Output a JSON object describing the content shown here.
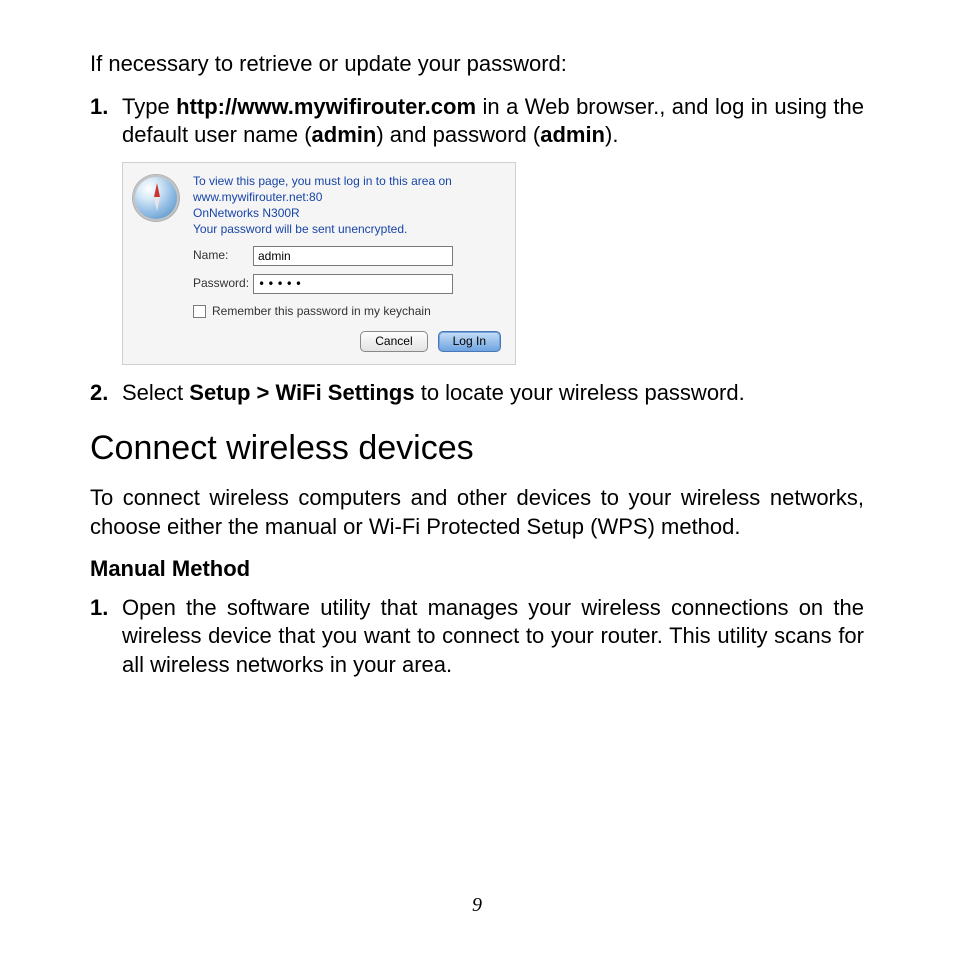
{
  "intro": "If necessary to retrieve or update your password:",
  "step1": {
    "num": "1.",
    "before": "Type ",
    "url": "http://www.mywifirouter.com",
    "mid1": " in a Web browser., and log in using the default user name (",
    "user": "admin",
    "mid2": ") and password (",
    "pass": "admin",
    "after": ")."
  },
  "dialog": {
    "msg_l1": "To view this page, you must log in to this area on",
    "msg_l2": "www.mywifirouter.net:80",
    "msg_l3": "OnNetworks N300R",
    "msg_l4": "Your password will be sent unencrypted.",
    "name_label": "Name:",
    "name_value": "admin",
    "password_label": "Password:",
    "password_value": "•••••",
    "remember_label": "Remember this password in my keychain",
    "cancel": "Cancel",
    "login": "Log In"
  },
  "step2": {
    "num": "2.",
    "before": "Select ",
    "bold": "Setup > WiFi Settings",
    "after": " to locate your wireless password."
  },
  "section_title": "Connect wireless devices",
  "para": "To connect wireless computers and other devices to your wireless networks, choose either the manual or Wi-Fi Protected Setup (WPS) method.",
  "manual_heading": "Manual Method",
  "step_m1": {
    "num": "1.",
    "text": "Open the software utility that manages your wireless connections on the wireless device that you want to connect to your router. This utility scans for all wireless networks in your area."
  },
  "page_number": "9"
}
